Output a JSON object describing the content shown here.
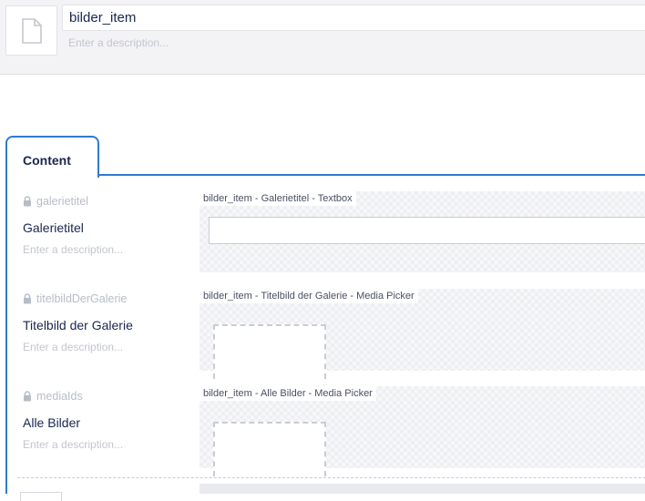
{
  "header": {
    "name": "bilder_item",
    "description_placeholder": "Enter a description..."
  },
  "tabs": [
    {
      "label": "Content"
    }
  ],
  "properties": [
    {
      "alias": "galerietitel",
      "label": "Galerietitel",
      "description_placeholder": "Enter a description...",
      "editor_caption": "bilder_item - Galerietitel - Textbox"
    },
    {
      "alias": "titelbildDerGalerie",
      "label": "Titelbild der Galerie",
      "description_placeholder": "Enter a description...",
      "editor_caption": "bilder_item - Titelbild der Galerie - Media Picker"
    },
    {
      "alias": "mediaIds",
      "label": "Alle Bilder",
      "description_placeholder": "Enter a description...",
      "editor_caption": "bilder_item - Alle Bilder - Media Picker"
    }
  ],
  "icons": {
    "document": "document-icon",
    "lock": "lock-icon"
  },
  "colors": {
    "accent": "#2e7bcf",
    "text": "#1b264f",
    "muted": "#b8bcc7"
  }
}
